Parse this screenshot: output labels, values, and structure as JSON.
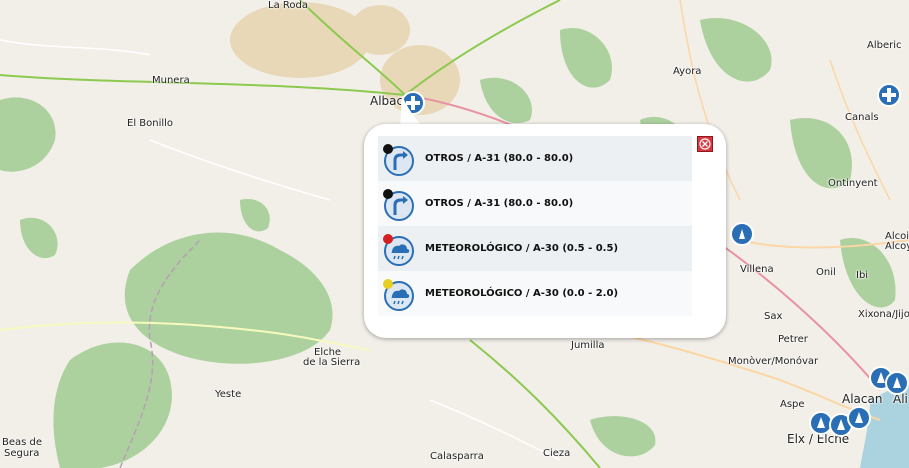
{
  "places": {
    "la_roda": "La Roda",
    "munera": "Munera",
    "el_bonillo": "El Bonillo",
    "albacete": "Albac",
    "ayora": "Ayora",
    "alberic": "Alberic",
    "canals": "Canals",
    "ontinyent": "Ontinyent",
    "alcoi": "Alcoi /",
    "alcoy": "Alcoy",
    "villena": "Villena",
    "onil": "Onil",
    "ibi": "Ibi",
    "sax": "Sax",
    "xixona": "Xixona/Jijona",
    "petrer": "Petrer",
    "monover": "Monòver/Monóvar",
    "jumilla": "Jumilla",
    "elche_sierra_1": "Elche",
    "elche_sierra_2": "de la Sierra",
    "yeste": "Yeste",
    "beas_1": "Beas de",
    "beas_2": "Segura",
    "aspe": "Aspe",
    "alacant": "Alacan",
    "ali": "Ali",
    "elx": "Elx / Elche",
    "calasparra": "Calasparra",
    "cieza": "Cieza"
  },
  "popup": {
    "rows": [
      {
        "label": "OTROS / A-31 (80.0 - 80.0)",
        "icon": "turn-arrow-icon",
        "pin_color": "#111111"
      },
      {
        "label": "OTROS / A-31 (80.0 - 80.0)",
        "icon": "turn-arrow-icon",
        "pin_color": "#111111"
      },
      {
        "label": "METEOROLÓGICO / A-30 (0.5 - 0.5)",
        "icon": "weather-icon",
        "pin_color": "#d42020"
      },
      {
        "label": "METEOROLÓGICO / A-30 (0.0 - 2.0)",
        "icon": "weather-icon",
        "pin_color": "#e8d020"
      }
    ]
  },
  "colors": {
    "forest": "#add19e",
    "marker_blue": "#2a6fb5",
    "popup_bg": "#ffffff",
    "close_red": "#d9363e"
  }
}
